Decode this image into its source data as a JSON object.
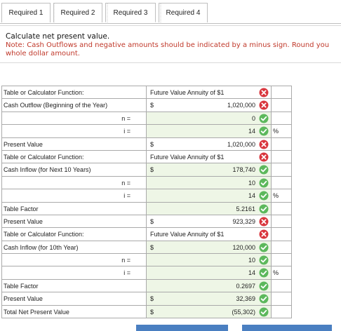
{
  "tabs": [
    {
      "label": "Required 1"
    },
    {
      "label": "Required 2"
    },
    {
      "label": "Required 3"
    },
    {
      "label": "Required 4"
    }
  ],
  "instructions": {
    "main": "Calculate net present value.",
    "note_line1": "Note: Cash Outflows and negative amounts should be indicated by a minus sign. Round you",
    "note_line2": "whole dollar amount."
  },
  "colors": {
    "check": "#5cb85c",
    "cross": "#d9363e",
    "input_bg": "#eef6e6",
    "button": "#4a7fc1"
  },
  "rows": [
    {
      "label": "Table or Calculator Function:",
      "value": "Future Value Annuity of $1",
      "status": "incorrect"
    },
    {
      "label": "Cash Outflow (Beginning of the Year)",
      "prefix": "$",
      "value": "1,020,000",
      "status": "incorrect"
    },
    {
      "label": "n =",
      "value": "0",
      "status": "correct"
    },
    {
      "label": "i =",
      "value": "14",
      "status": "correct",
      "suffix": "%"
    },
    {
      "label": "Present Value",
      "prefix": "$",
      "value": "1,020,000",
      "status": "incorrect"
    },
    {
      "label": "Table or Calculator Function:",
      "value": "Future Value Annuity of $1",
      "status": "incorrect"
    },
    {
      "label": "Cash Inflow (for Next 10 Years)",
      "prefix": "$",
      "value": "178,740",
      "status": "correct"
    },
    {
      "label": "n =",
      "value": "10",
      "status": "correct"
    },
    {
      "label": "i =",
      "value": "14",
      "status": "correct",
      "suffix": "%"
    },
    {
      "label": "Table Factor",
      "value": "5.2161",
      "status": "correct"
    },
    {
      "label": "Present Value",
      "prefix": "$",
      "value": "923,329",
      "status": "incorrect"
    },
    {
      "label": "Table or Calculator Function:",
      "value": "Future Value Annuity of $1",
      "status": "incorrect"
    },
    {
      "label": "Cash Inflow (for 10th Year)",
      "prefix": "$",
      "value": "120,000",
      "status": "correct"
    },
    {
      "label": "n =",
      "value": "10",
      "status": "correct"
    },
    {
      "label": "i =",
      "value": "14",
      "status": "correct",
      "suffix": "%"
    },
    {
      "label": "Table Factor",
      "value": "0.2697",
      "status": "correct"
    },
    {
      "label": "Present Value",
      "prefix": "$",
      "value": "32,369",
      "status": "correct"
    },
    {
      "label": "Total Net Present Value",
      "prefix": "$",
      "value": "(55,302)",
      "status": "correct"
    }
  ]
}
